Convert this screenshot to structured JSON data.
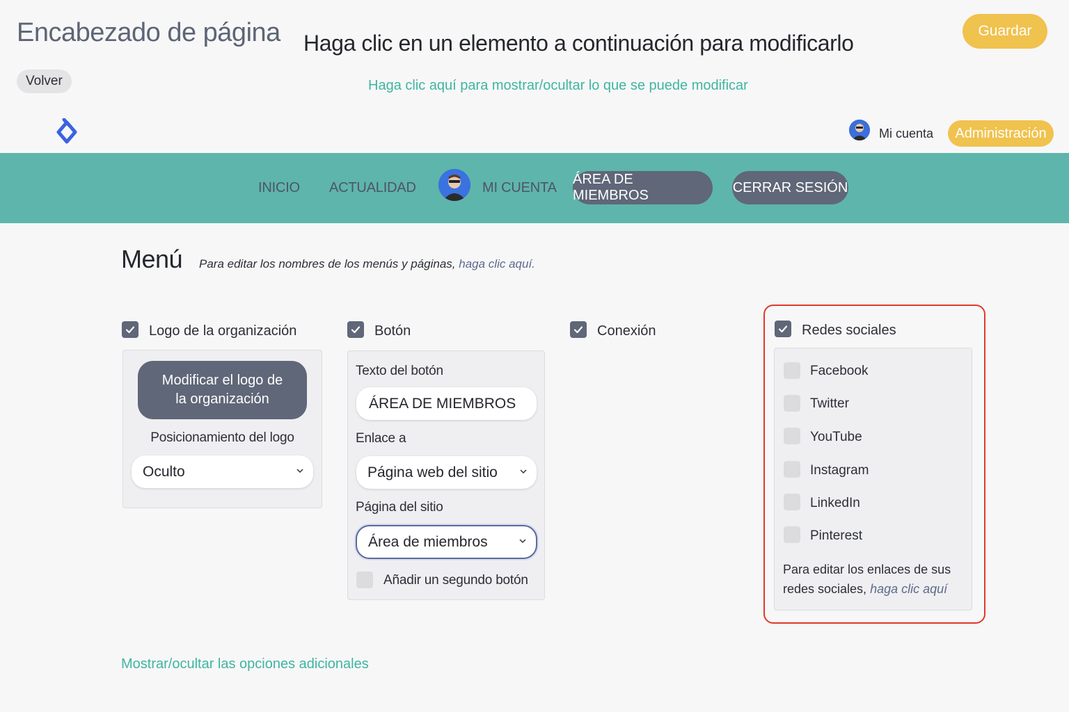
{
  "editor": {
    "page_title": "Encabezado de página",
    "back_label": "Volver",
    "instruction": "Haga clic en un elemento a continuación para modificarlo",
    "toggle_link": "Haga clic aquí para mostrar/ocultar lo que se puede modificar",
    "save_label": "Guardar"
  },
  "preview_header": {
    "logo_icon": "diamond-logo-icon",
    "account_label": "Mi cuenta",
    "admin_label": "Administración",
    "nav": {
      "home": "INICIO",
      "news": "ACTUALIDAD",
      "account": "MI CUENTA",
      "members": "ÁREA DE MIEMBROS",
      "logout": "CERRAR SESIÓN"
    },
    "colors": {
      "nav_bg": "#5eb5ab",
      "accent_yellow": "#f0c24e",
      "pill": "#5f6778"
    }
  },
  "menu": {
    "title": "Menú",
    "hint_text": "Para editar los nombres de los menús y páginas, ",
    "hint_link": "haga clic aquí."
  },
  "logo_column": {
    "label": "Logo de la organización",
    "checked": true,
    "modify_button": "Modificar el logo de la organización",
    "position_label": "Posicionamiento del logo",
    "position_value": "Oculto"
  },
  "button_column": {
    "label": "Botón",
    "checked": true,
    "text_label": "Texto del botón",
    "text_value": "ÁREA DE MIEMBROS",
    "link_label": "Enlace a",
    "link_value": "Página web del sitio",
    "page_label": "Página del sitio",
    "page_value": "Área de miembros",
    "second_button_label": "Añadir un segundo botón",
    "second_button_checked": false
  },
  "connection_column": {
    "label": "Conexión",
    "checked": true
  },
  "social_column": {
    "label": "Redes sociales",
    "checked": true,
    "items": [
      {
        "label": "Facebook",
        "checked": false
      },
      {
        "label": "Twitter",
        "checked": false
      },
      {
        "label": "YouTube",
        "checked": false
      },
      {
        "label": "Instagram",
        "checked": false
      },
      {
        "label": "LinkedIn",
        "checked": false
      },
      {
        "label": "Pinterest",
        "checked": false
      }
    ],
    "note_text": "Para editar los enlaces de sus redes sociales, ",
    "note_link": "haga clic aquí"
  },
  "more_options_link": "Mostrar/ocultar las opciones adicionales"
}
